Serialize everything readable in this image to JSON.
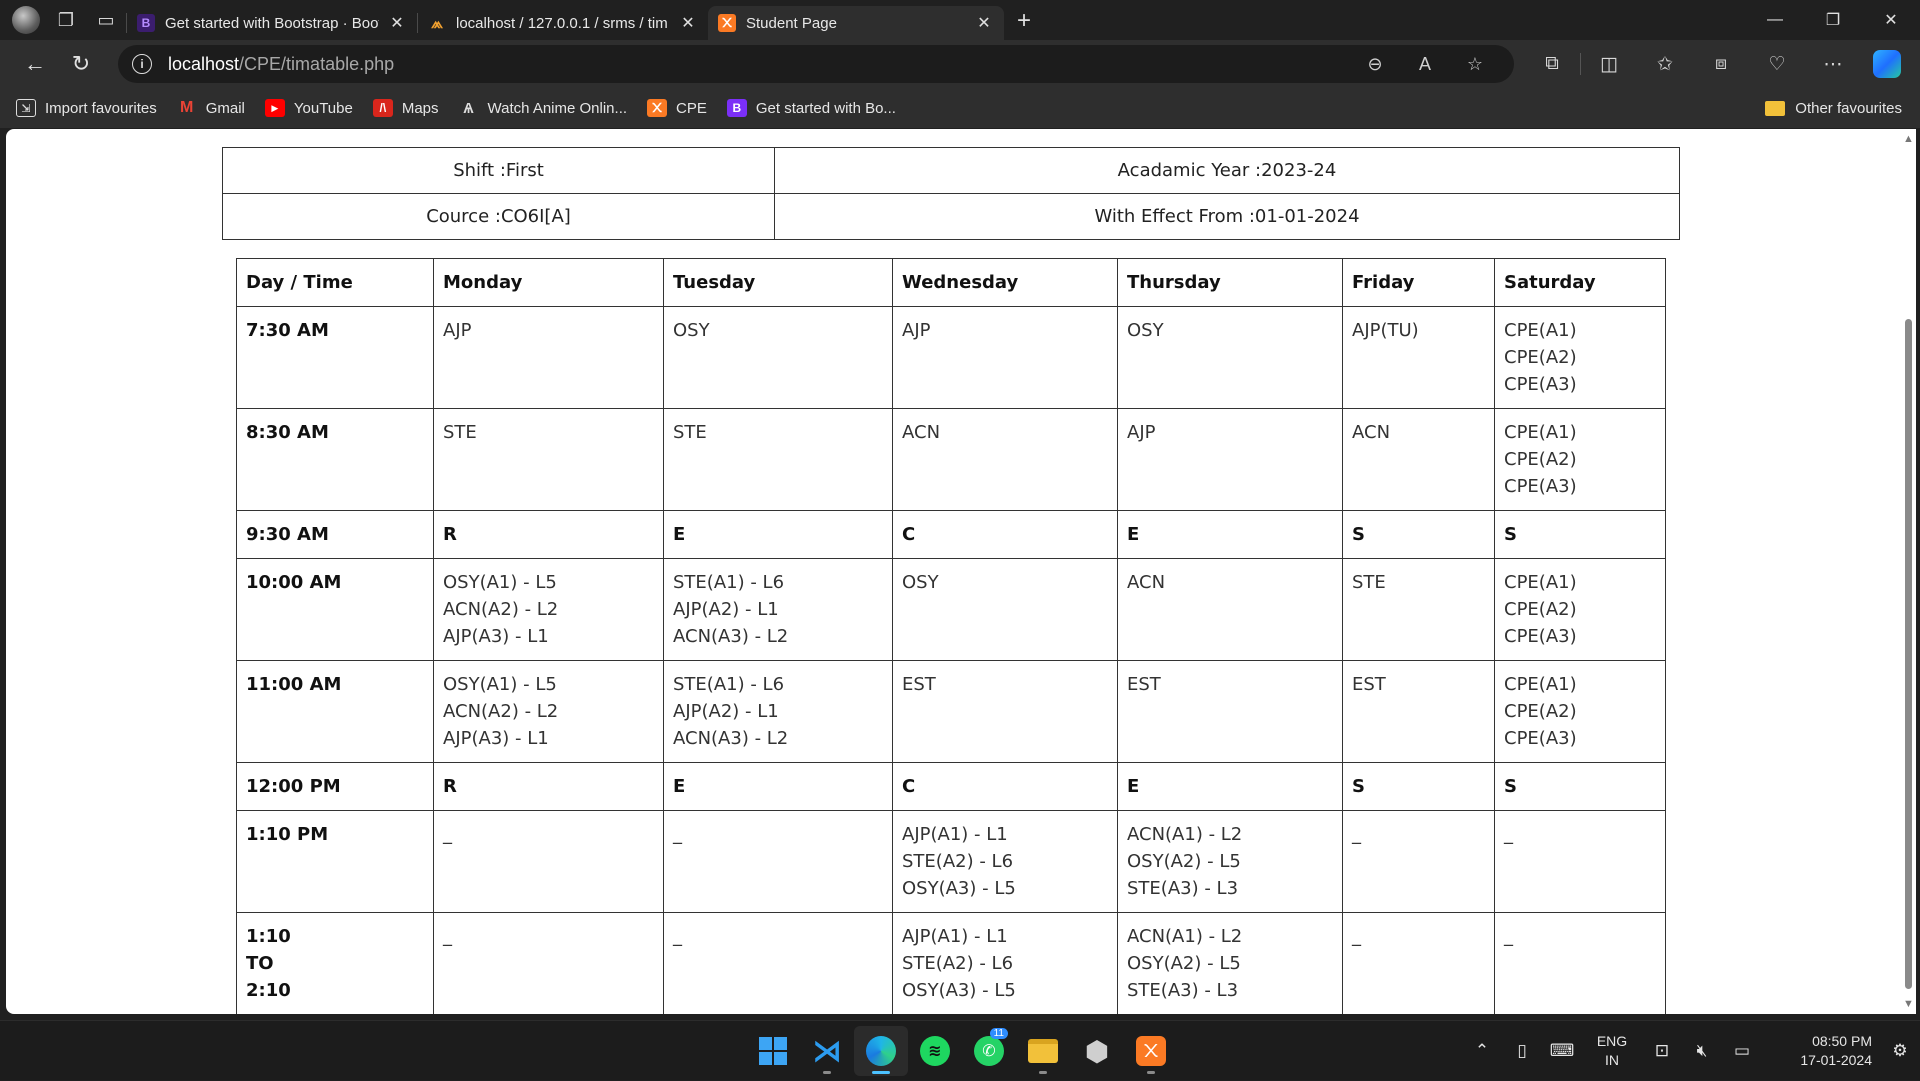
{
  "browser": {
    "tabs": [
      {
        "title": "Get started with Bootstrap · Boot",
        "favicon": "bootstrap-icon",
        "active": false
      },
      {
        "title": "localhost / 127.0.0.1 / srms / tim",
        "favicon": "phpmyadmin-icon",
        "active": false
      },
      {
        "title": "Student Page",
        "favicon": "xampp-icon",
        "active": true
      }
    ],
    "url_host": "localhost",
    "url_path": "/CPE/timatable.php",
    "favourites": [
      {
        "label": "Import favourites",
        "icon": "import-icon"
      },
      {
        "label": "Gmail",
        "icon": "gmail-icon"
      },
      {
        "label": "YouTube",
        "icon": "youtube-icon"
      },
      {
        "label": "Maps",
        "icon": "maps-icon"
      },
      {
        "label": "Watch Anime Onlin...",
        "icon": "anime-icon"
      },
      {
        "label": "CPE",
        "icon": "xampp-icon"
      },
      {
        "label": "Get started with Bo...",
        "icon": "bootstrap-icon"
      }
    ],
    "other_favourites": "Other favourites"
  },
  "info": {
    "shift": "Shift :First",
    "year": "Acadamic Year :2023-24",
    "course": "Cource :CO6I[A]",
    "effect": "With Effect From :01-01-2024"
  },
  "timetable": {
    "headers": [
      "Day / Time",
      "Monday",
      "Tuesday",
      "Wednesday",
      "Thursday",
      "Friday",
      "Saturday"
    ],
    "rows": [
      {
        "time": "7:30 AM",
        "type": "tall",
        "cells": [
          [
            "AJP"
          ],
          [
            "OSY"
          ],
          [
            "AJP"
          ],
          [
            "OSY"
          ],
          [
            "AJP(TU)"
          ],
          [
            "CPE(A1)",
            "CPE(A2)",
            "CPE(A3)"
          ]
        ]
      },
      {
        "time": "8:30 AM",
        "type": "tall",
        "cells": [
          [
            "STE"
          ],
          [
            "STE"
          ],
          [
            "ACN"
          ],
          [
            "AJP"
          ],
          [
            "ACN"
          ],
          [
            "CPE(A1)",
            "CPE(A2)",
            "CPE(A3)"
          ]
        ]
      },
      {
        "time": "9:30 AM",
        "type": "short",
        "cells": [
          [
            "R"
          ],
          [
            "E"
          ],
          [
            "C"
          ],
          [
            "E"
          ],
          [
            "S"
          ],
          [
            "S"
          ]
        ]
      },
      {
        "time": "10:00 AM",
        "type": "tall",
        "cells": [
          [
            "OSY(A1) - L5",
            "ACN(A2) - L2",
            "AJP(A3) - L1"
          ],
          [
            "STE(A1) - L6",
            "AJP(A2) - L1",
            "ACN(A3) - L2"
          ],
          [
            "OSY"
          ],
          [
            "ACN"
          ],
          [
            "STE"
          ],
          [
            "CPE(A1)",
            "CPE(A2)",
            "CPE(A3)"
          ]
        ]
      },
      {
        "time": "11:00 AM",
        "type": "tall",
        "cells": [
          [
            "OSY(A1) - L5",
            "ACN(A2) - L2",
            "AJP(A3) - L1"
          ],
          [
            "STE(A1) - L6",
            "AJP(A2) - L1",
            "ACN(A3) - L2"
          ],
          [
            "EST"
          ],
          [
            "EST"
          ],
          [
            "EST"
          ],
          [
            "CPE(A1)",
            "CPE(A2)",
            "CPE(A3)"
          ]
        ]
      },
      {
        "time": "12:00 PM",
        "type": "short",
        "cells": [
          [
            "R"
          ],
          [
            "E"
          ],
          [
            "C"
          ],
          [
            "E"
          ],
          [
            "S"
          ],
          [
            "S"
          ]
        ]
      },
      {
        "time": "1:10 PM",
        "type": "tall",
        "cells": [
          [
            "_"
          ],
          [
            "_"
          ],
          [
            "AJP(A1) - L1",
            "STE(A2) - L6",
            "OSY(A3) - L5"
          ],
          [
            "ACN(A1) - L2",
            "OSY(A2) - L5",
            "STE(A3) - L3"
          ],
          [
            "_"
          ],
          [
            "_"
          ]
        ]
      },
      {
        "time": "1:10\nTO\n2:10",
        "type": "tall",
        "cells": [
          [
            "_"
          ],
          [
            "_"
          ],
          [
            "AJP(A1) - L1",
            "STE(A2) - L6",
            "OSY(A3) - L5"
          ],
          [
            "ACN(A1) - L2",
            "OSY(A2) - L5",
            "STE(A3) - L3"
          ],
          [
            "_"
          ],
          [
            "_"
          ]
        ]
      }
    ]
  },
  "taskbar": {
    "apps": [
      {
        "name": "start-button",
        "active": false
      },
      {
        "name": "vscode-app",
        "active": false
      },
      {
        "name": "edge-app",
        "active": true
      },
      {
        "name": "spotify-app",
        "active": false
      },
      {
        "name": "whatsapp-app",
        "active": false,
        "badge": "11"
      },
      {
        "name": "file-explorer-app",
        "active": false
      },
      {
        "name": "unity-app",
        "active": false
      },
      {
        "name": "xampp-app",
        "active": false
      }
    ],
    "lang_top": "ENG",
    "lang_bottom": "IN",
    "time": "08:50 PM",
    "date": "17-01-2024"
  },
  "colors": {
    "accent": "#4cc2ff",
    "bootstrap": "#7b2ff7",
    "xampp": "#fb7a24",
    "youtube": "#ff0000",
    "gmail": "#ea4335"
  }
}
